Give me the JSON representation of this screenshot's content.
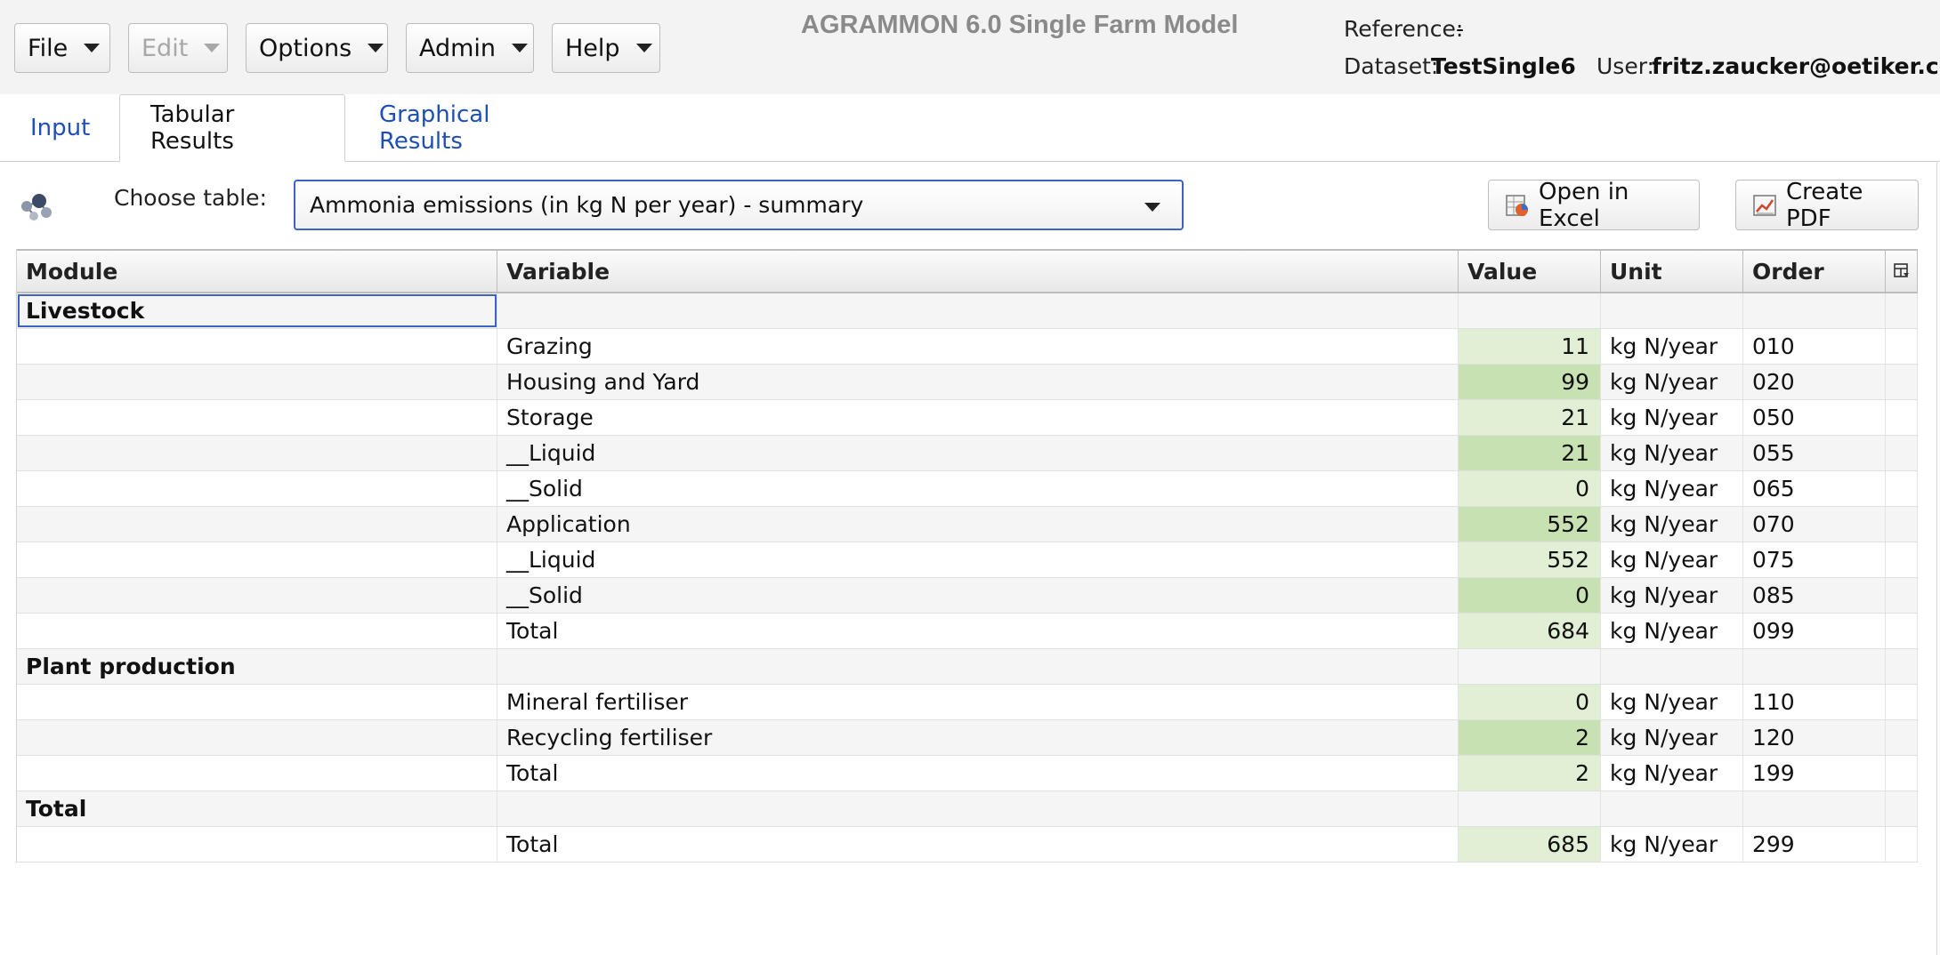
{
  "menubar": {
    "file": "File",
    "edit": "Edit",
    "options": "Options",
    "admin": "Admin",
    "help": "Help"
  },
  "app_title": "AGRAMMON 6.0 Single Farm Model",
  "header_info": {
    "reference_label": "Reference:",
    "reference_value": "-",
    "dataset_label": "Dataset:",
    "dataset_value": "TestSingle6",
    "user_label": "User:",
    "user_value": "fritz.zaucker@oetiker.ch"
  },
  "tabs": [
    {
      "label": "Input",
      "active": false
    },
    {
      "label": "Tabular Results",
      "active": true
    },
    {
      "label": "Graphical Results",
      "active": false
    }
  ],
  "controls": {
    "choose_label": "Choose table:",
    "selected_table": "Ammonia emissions (in kg N per year) - summary",
    "open_excel": "Open in Excel",
    "create_pdf": "Create PDF"
  },
  "table": {
    "columns": [
      "Module",
      "Variable",
      "Value",
      "Unit",
      "Order"
    ],
    "rows": [
      {
        "module": "Livestock",
        "variable": "",
        "value": "",
        "unit": "",
        "order": ""
      },
      {
        "module": "",
        "variable": "Grazing",
        "value": "11",
        "unit": "kg N/year",
        "order": "010"
      },
      {
        "module": "",
        "variable": "Housing and Yard",
        "value": "99",
        "unit": "kg N/year",
        "order": "020"
      },
      {
        "module": "",
        "variable": "Storage",
        "value": "21",
        "unit": "kg N/year",
        "order": "050"
      },
      {
        "module": "",
        "variable": "__Liquid",
        "value": "21",
        "unit": "kg N/year",
        "order": "055"
      },
      {
        "module": "",
        "variable": "__Solid",
        "value": "0",
        "unit": "kg N/year",
        "order": "065"
      },
      {
        "module": "",
        "variable": "Application",
        "value": "552",
        "unit": "kg N/year",
        "order": "070"
      },
      {
        "module": "",
        "variable": "__Liquid",
        "value": "552",
        "unit": "kg N/year",
        "order": "075"
      },
      {
        "module": "",
        "variable": "__Solid",
        "value": "0",
        "unit": "kg N/year",
        "order": "085"
      },
      {
        "module": "",
        "variable": "Total",
        "value": "684",
        "unit": "kg N/year",
        "order": "099"
      },
      {
        "module": "Plant production",
        "variable": "",
        "value": "",
        "unit": "",
        "order": ""
      },
      {
        "module": "",
        "variable": "Mineral fertiliser",
        "value": "0",
        "unit": "kg N/year",
        "order": "110"
      },
      {
        "module": "",
        "variable": "Recycling fertiliser",
        "value": "2",
        "unit": "kg N/year",
        "order": "120"
      },
      {
        "module": "",
        "variable": "Total",
        "value": "2",
        "unit": "kg N/year",
        "order": "199"
      },
      {
        "module": "Total",
        "variable": "",
        "value": "",
        "unit": "",
        "order": ""
      },
      {
        "module": "",
        "variable": "Total",
        "value": "685",
        "unit": "kg N/year",
        "order": "299"
      }
    ]
  },
  "colors": {
    "value_dark": "#c8e1b2",
    "value_light": "#e1efd5",
    "link_blue": "#1e4fb4",
    "focus_blue": "#3b63c4"
  }
}
